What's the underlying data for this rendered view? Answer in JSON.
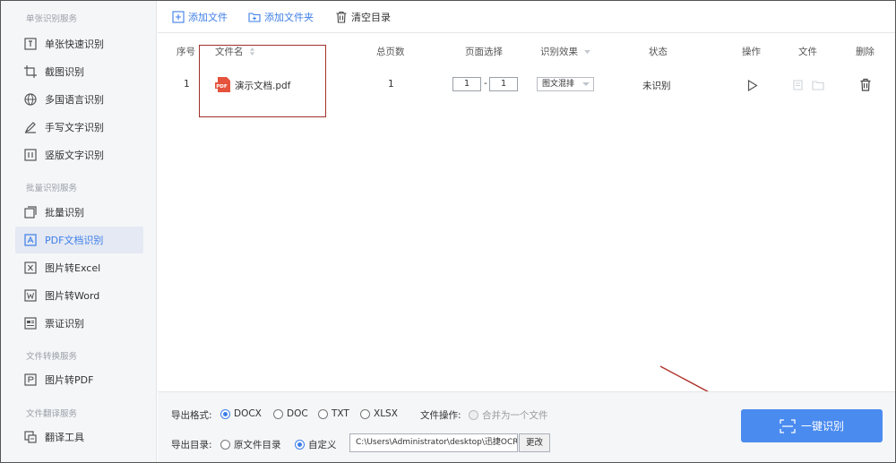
{
  "sidebar": {
    "sections": [
      {
        "title": "单张识别服务"
      },
      {
        "title": "批量识别服务"
      },
      {
        "title": "文件转换服务"
      },
      {
        "title": "文件翻译服务"
      }
    ],
    "items": [
      {
        "label": "单张快速识别",
        "icon": "image-text-icon"
      },
      {
        "label": "截图识别",
        "icon": "crop-icon"
      },
      {
        "label": "多国语言识别",
        "icon": "globe-icon"
      },
      {
        "label": "手写文字识别",
        "icon": "pen-icon"
      },
      {
        "label": "竖版文字识别",
        "icon": "vertical-text-icon"
      },
      {
        "label": "批量识别",
        "icon": "batch-icon"
      },
      {
        "label": "PDF文档识别",
        "icon": "pdf-icon"
      },
      {
        "label": "图片转Excel",
        "icon": "excel-icon"
      },
      {
        "label": "图片转Word",
        "icon": "word-icon"
      },
      {
        "label": "票证识别",
        "icon": "ticket-icon"
      },
      {
        "label": "图片转PDF",
        "icon": "pdf-convert-icon"
      },
      {
        "label": "翻译工具",
        "icon": "translate-icon"
      }
    ]
  },
  "toolbar": {
    "add_file": "添加文件",
    "add_folder": "添加文件夹",
    "clear": "清空目录"
  },
  "table": {
    "headers": [
      "序号",
      "文件名",
      "总页数",
      "页面选择",
      "识别效果",
      "状态",
      "操作",
      "文件",
      "删除"
    ],
    "rows": [
      {
        "index": "1",
        "file_badge": "PDF",
        "filename": "演示文档.pdf",
        "pages": "1",
        "page_from": "1",
        "page_sep": "-",
        "page_to": "1",
        "effect": "图文混排",
        "status": "未识别"
      }
    ]
  },
  "bottom": {
    "format_label": "导出格式:",
    "formats": [
      "DOCX",
      "DOC",
      "TXT",
      "XLSX"
    ],
    "selected_format": "DOCX",
    "file_op_label": "文件操作:",
    "merge_label": "合并为一个文件",
    "dir_label": "导出目录:",
    "dir_options": [
      "原文件目录",
      "自定义"
    ],
    "selected_dir": "自定义",
    "path_value": "C:\\Users\\Administrator\\desktop\\迅捷OCR文",
    "change_label": "更改",
    "ocr_button": "一键识别"
  },
  "colors": {
    "accent": "#4a8bf0",
    "link": "#3d7ee8",
    "highlight_box": "#a0302a",
    "annotation_arrow": "#b03028",
    "pdf_badge": "#e5533d"
  }
}
